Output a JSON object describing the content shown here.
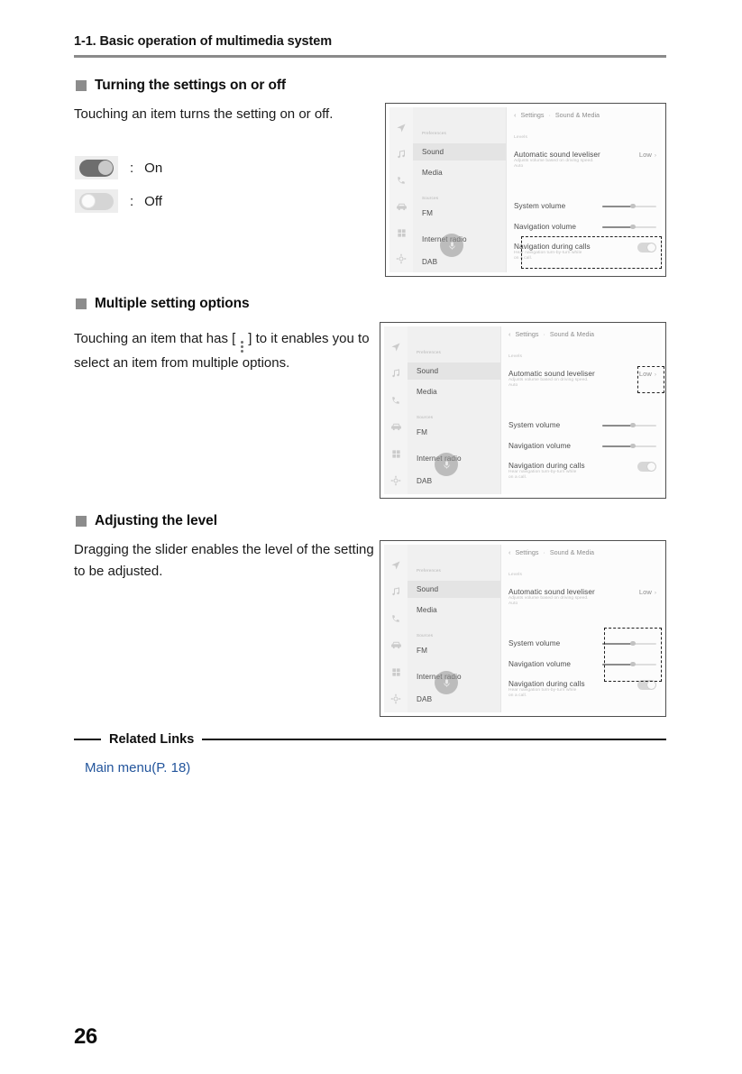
{
  "page": {
    "running_head": "1-1. Basic operation of multimedia system",
    "page_number": "26"
  },
  "sections": [
    {
      "heading": "Turning the settings on or off",
      "body": "Touching an item turns the setting on or off."
    },
    {
      "heading": "Multiple setting options",
      "body_before": "Touching an item that has [",
      "body_after": "] to it enables you to select an item from multiple options.",
      "icon": "kebab-menu-icon"
    },
    {
      "heading": "Adjusting the level",
      "body": "Dragging the slider enables the level of the setting to be adjusted."
    }
  ],
  "toggle_legend": [
    {
      "state": "on",
      "colon": ":",
      "label": "On"
    },
    {
      "state": "off",
      "colon": ":",
      "label": "Off"
    }
  ],
  "screen": {
    "breadcrumb": {
      "back": "‹",
      "root": "Settings",
      "separator": "·",
      "current": "Sound & Media"
    },
    "rail_icons": [
      "navigation-arrow-icon",
      "music-note-icon",
      "phone-icon",
      "car-icon",
      "apps-grid-icon",
      "gear-icon"
    ],
    "menu": {
      "group1_label": "Preferences",
      "group1_items": [
        "Sound",
        "Media"
      ],
      "group2_label": "Sources",
      "group2_items": [
        "FM",
        "Internet radio",
        "DAB"
      ],
      "selected": "Sound"
    },
    "content": {
      "group_label": "Levels",
      "rows": [
        {
          "name": "Automatic sound leveliser",
          "sub": "Adjusts volume based on driving speed.",
          "sub2": "Auto",
          "value": "Low",
          "chevron": "›",
          "control": "value"
        },
        {
          "name": "System volume",
          "control": "slider",
          "fill_percent": 55
        },
        {
          "name": "Navigation volume",
          "control": "slider",
          "fill_percent": 55
        },
        {
          "name": "Navigation during calls",
          "sub": "Hear navigation turn-by-turn while",
          "sub2": "on a call.",
          "control": "toggle",
          "toggle_state": "on"
        }
      ]
    }
  },
  "callouts": {
    "panel1": "navigation-during-calls-row",
    "panel2": "automatic-sound-leveliser-value",
    "panel3": "volume-sliders"
  },
  "related_links": {
    "title": "Related Links",
    "links": [
      {
        "label": "Main menu(P. 18)"
      }
    ]
  },
  "colors": {
    "link": "#23559c",
    "rule": "#8a8a8a",
    "bullet": "#8c8c8c"
  }
}
